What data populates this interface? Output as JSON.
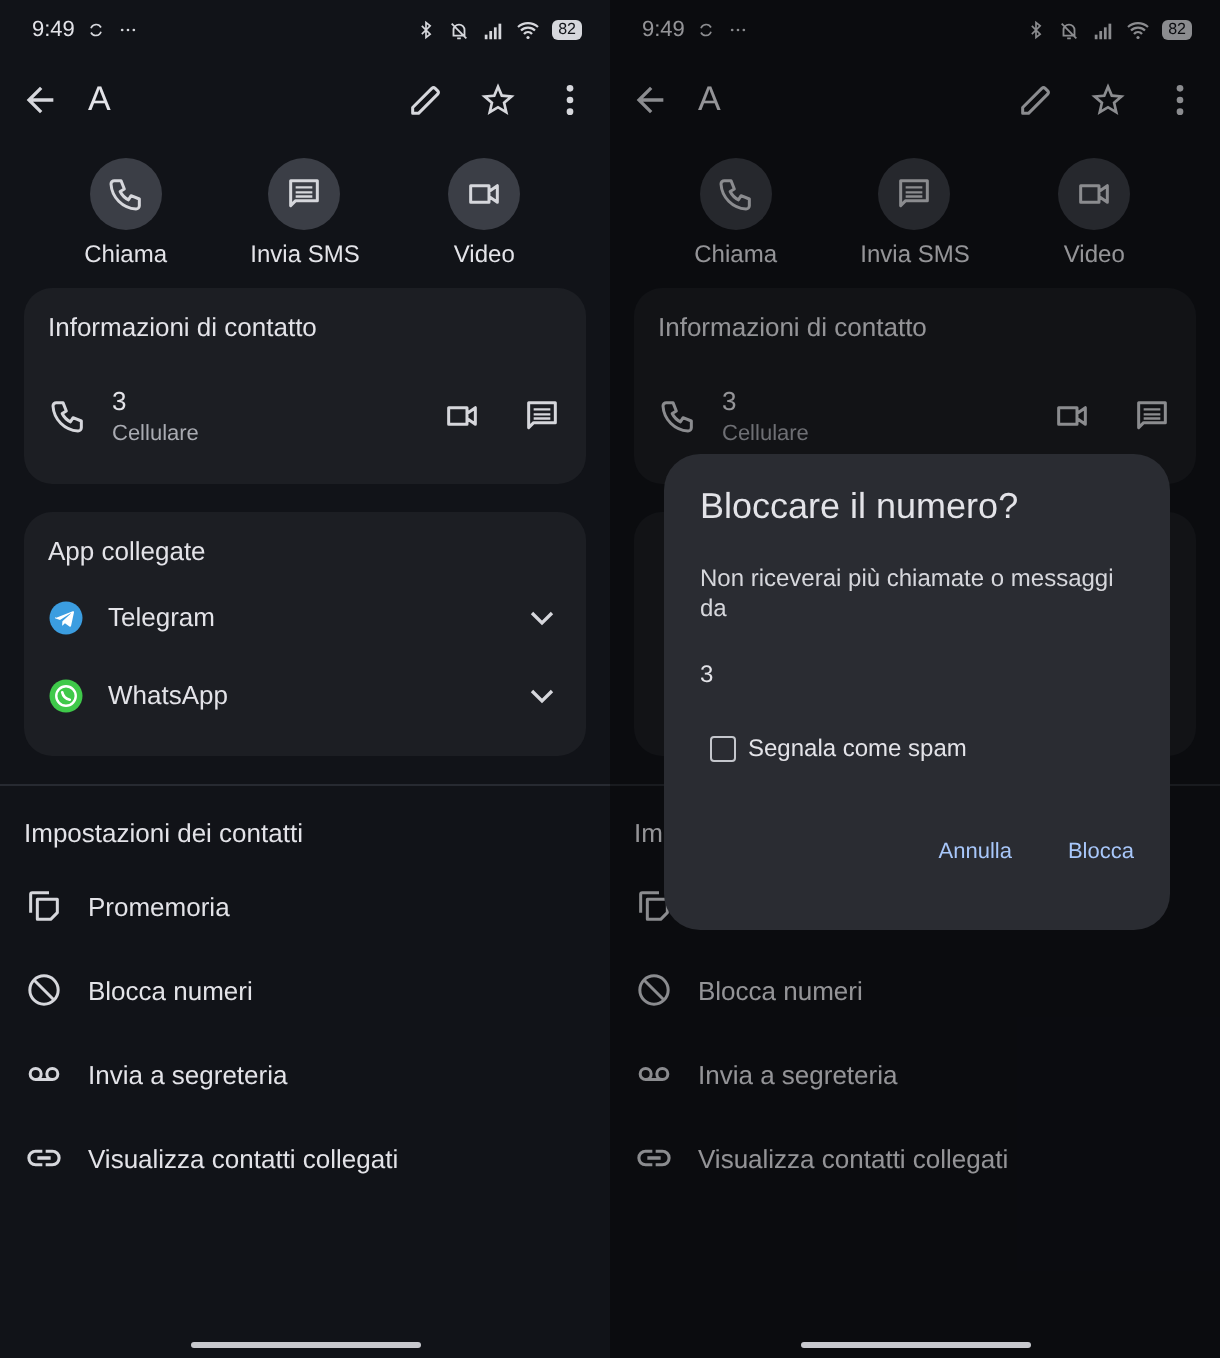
{
  "screens": [
    {
      "status_bar": {
        "time": "9:49",
        "battery": "82"
      },
      "toolbar": {
        "title": "A"
      },
      "actions": [
        {
          "kind": "call",
          "label": "Chiama"
        },
        {
          "kind": "sms",
          "label": "Invia SMS"
        },
        {
          "kind": "video",
          "label": "Video"
        }
      ],
      "contact_info": {
        "title": "Informazioni di contatto",
        "number": "3",
        "type": "Cellulare"
      },
      "linked_apps": {
        "title": "App collegate",
        "items": [
          {
            "kind": "telegram",
            "label": "Telegram",
            "expanded": false
          },
          {
            "kind": "whatsapp",
            "label": "WhatsApp",
            "expanded": false
          }
        ]
      },
      "settings": {
        "title": "Impostazioni dei contatti",
        "items": [
          {
            "kind": "reminder",
            "label": "Promemoria"
          },
          {
            "kind": "block",
            "label": "Blocca numeri"
          },
          {
            "kind": "voicemail",
            "label": "Invia a segreteria"
          },
          {
            "kind": "link",
            "label": "Visualizza contatti collegati"
          }
        ]
      }
    },
    {
      "status_bar": {
        "time": "9:49",
        "battery": "82"
      },
      "toolbar": {
        "title": "A"
      },
      "actions": [
        {
          "kind": "call",
          "label": "Chiama"
        },
        {
          "kind": "sms",
          "label": "Invia SMS"
        },
        {
          "kind": "video",
          "label": "Video"
        }
      ],
      "contact_info": {
        "title": "Informazioni di contatto",
        "number": "3",
        "type": "Cellulare"
      },
      "settings": {
        "title": "Im",
        "items": [
          {
            "kind": "reminder"
          },
          {
            "kind": "block",
            "label": "Blocca numeri"
          },
          {
            "kind": "voicemail",
            "label": "Invia a segreteria"
          },
          {
            "kind": "link",
            "label": "Visualizza contatti collegati"
          }
        ]
      },
      "dialog": {
        "title": "Bloccare il numero?",
        "message": "Non riceverai più chiamate o messaggi da",
        "number": "3",
        "checkbox": {
          "label": "Segnala come spam",
          "checked": false
        },
        "buttons": [
          "Annulla",
          "Blocca"
        ]
      }
    }
  ]
}
